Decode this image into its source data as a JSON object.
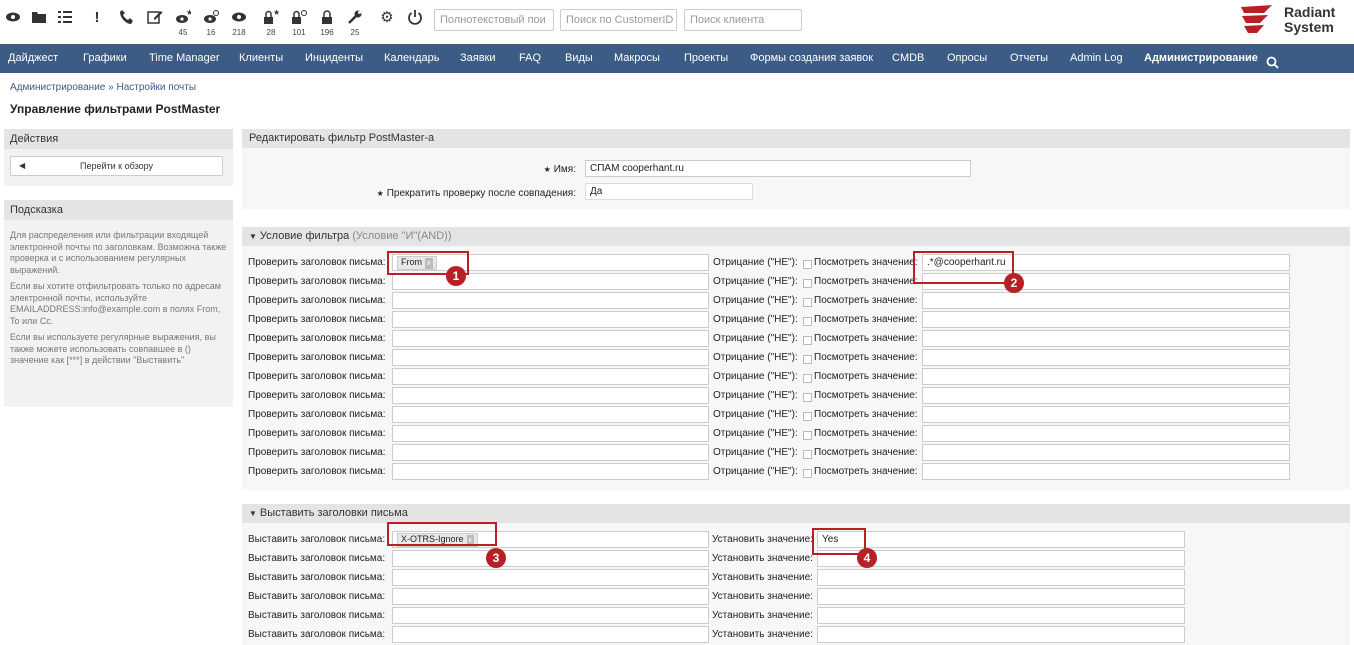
{
  "toolbar": {
    "icons": [
      "eye-icon",
      "folder-icon",
      "list-icon",
      "exclamation-icon",
      "phone-icon",
      "edit-icon",
      "eye-star-icon",
      "eye-clock-icon",
      "eye-icon",
      "lock-star-icon",
      "lock-clock-icon",
      "lock-icon",
      "wrench-icon",
      "gear-icon",
      "power-icon"
    ],
    "counts": [
      "45",
      "16",
      "218",
      "28",
      "101",
      "196",
      "25"
    ],
    "fulltext_placeholder": "Полнотекстовый пои",
    "customerid_placeholder": "Поиск по CustomerID",
    "customer_placeholder": "Поиск клиента"
  },
  "logo": {
    "line1": "Radiant",
    "line2": "System",
    "color": "#b72025"
  },
  "nav": {
    "items": [
      "Дайджест",
      "Графики",
      "Time Manager",
      "Клиенты",
      "Инциденты",
      "Календарь",
      "Заявки",
      "FAQ",
      "Виды",
      "Макросы",
      "Проекты",
      "Формы создания заявок",
      "CMDB",
      "Опросы",
      "Отчеты",
      "Admin Log",
      "Администрирование"
    ],
    "active": "Администрирование",
    "search_icon": "search-icon",
    "bg_color": "#3d5c85"
  },
  "breadcrumb": "Администрирование » Настройки почты",
  "page_title": "Управление фильтрами PostMaster",
  "sidebar": {
    "actions_title": "Действия",
    "back_button": "Перейти к обзору",
    "hint_title": "Подсказка",
    "hint_paragraphs": [
      "Для распределения или фильтрации входящей электронной почты по заголовкам. Возможна также проверка и с использованием регулярных выражений.",
      "Если вы хотите отфильтровать только по адресам электронной почты, используйте EMAILADDRESS:info@example.com в полях From, To или Cc.",
      "Если вы используете регулярные выражения, вы также можете использовать совпавшее в () значение как [***] в действии \"Выставить\""
    ]
  },
  "edit_panel": {
    "title": "Редактировать фильтр PostMaster-a",
    "name_label": "Имя:",
    "name_value": "СПАМ cooperhant.ru",
    "stop_label": "Прекратить проверку после совпадения:",
    "stop_value": "Да"
  },
  "condition_panel": {
    "title": "Условие фильтра",
    "subtitle": "(Условие \"И\"(AND))",
    "header_label": "Проверить заголовок письма:",
    "not_label": "Отрицание (\"НЕ\"):",
    "value_label": "Посмотреть значение:",
    "rows": [
      {
        "header": "From",
        "value": ".*@cooperhant.ru"
      },
      {
        "header": "",
        "value": ""
      },
      {
        "header": "",
        "value": ""
      },
      {
        "header": "",
        "value": ""
      },
      {
        "header": "",
        "value": ""
      },
      {
        "header": "",
        "value": ""
      },
      {
        "header": "",
        "value": ""
      },
      {
        "header": "",
        "value": ""
      },
      {
        "header": "",
        "value": ""
      },
      {
        "header": "",
        "value": ""
      },
      {
        "header": "",
        "value": ""
      },
      {
        "header": "",
        "value": ""
      }
    ]
  },
  "set_panel": {
    "title": "Выставить заголовки письма",
    "header_label": "Выставить заголовок письма:",
    "value_label": "Установить значение:",
    "rows": [
      {
        "header": "X-OTRS-Ignore",
        "value": "Yes"
      },
      {
        "header": "",
        "value": ""
      },
      {
        "header": "",
        "value": ""
      },
      {
        "header": "",
        "value": ""
      },
      {
        "header": "",
        "value": ""
      },
      {
        "header": "",
        "value": ""
      }
    ]
  },
  "callouts": [
    "1",
    "2",
    "3",
    "4"
  ],
  "accent_color": "#b72025"
}
